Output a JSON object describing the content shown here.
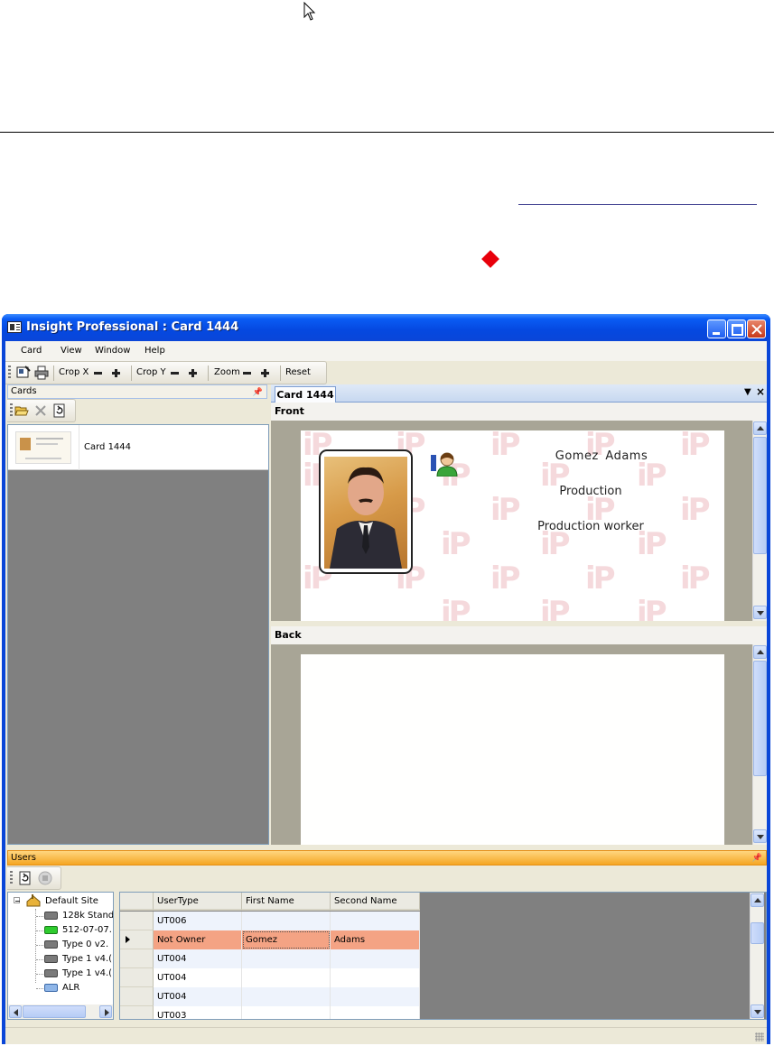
{
  "window": {
    "title": "Insight Professional : Card 1444"
  },
  "menubar": [
    "Card",
    "View",
    "Window",
    "Help"
  ],
  "toolbar": {
    "crop_x": "Crop X",
    "crop_y": "Crop Y",
    "zoom": "Zoom",
    "reset": "Reset"
  },
  "cards_panel": {
    "title": "Cards",
    "items": [
      {
        "label": "Card 1444"
      }
    ]
  },
  "document": {
    "tab_label": "Card 1444",
    "front_label": "Front",
    "back_label": "Back",
    "card": {
      "name": "Gomez  Adams",
      "department": "Production",
      "role": "Production worker",
      "watermark": "iP"
    }
  },
  "users_panel": {
    "title": "Users",
    "tree": {
      "root": "Default Site",
      "children": [
        "128k Stand",
        "512-07-07.",
        "Type 0 v2.",
        "Type 1 v4.(",
        "Type 1 v4.(",
        "ALR"
      ]
    },
    "grid": {
      "columns": [
        "UserType",
        "First Name",
        "Second Name"
      ],
      "rows": [
        {
          "usertype": "UT006",
          "first": "",
          "second": ""
        },
        {
          "usertype": "Not Owner",
          "first": "Gomez",
          "second": "Adams"
        },
        {
          "usertype": "UT004",
          "first": "",
          "second": ""
        },
        {
          "usertype": "UT004",
          "first": "",
          "second": ""
        },
        {
          "usertype": "UT004",
          "first": "",
          "second": ""
        },
        {
          "usertype": "UT003",
          "first": "",
          "second": ""
        }
      ],
      "selected_row": 1,
      "selected_color": "#f4a384"
    }
  },
  "colors": {
    "titlebar": "#0a46d8",
    "users_header": "#f5a623",
    "marker": "#e8000b"
  }
}
